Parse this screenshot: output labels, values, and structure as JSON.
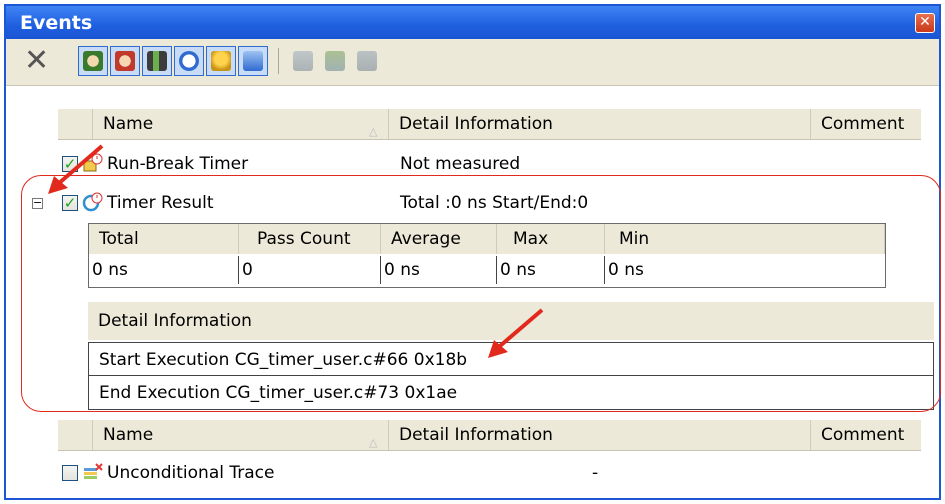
{
  "window": {
    "title": "Events",
    "close_icon": "close-icon"
  },
  "toolbar": {
    "delete_icon": "delete-icon",
    "buttons": [
      "hardware-break-icon",
      "software-break-icon",
      "trace-icon",
      "timer-icon",
      "bell-icon",
      "display-icon"
    ],
    "disabled_buttons": [
      "edit-icon",
      "enable-icon",
      "disable-icon"
    ]
  },
  "columns": {
    "name": "Name",
    "detail": "Detail Information",
    "comment": "Comment"
  },
  "events": [
    {
      "name": "Run-Break Timer",
      "detail": "Not measured",
      "checked": true
    },
    {
      "name": "Timer Result",
      "detail": "Total :0 ns  Start/End:0",
      "checked": true,
      "expanded": true
    },
    {
      "name": "Unconditional Trace",
      "detail": "-",
      "checked": false
    }
  ],
  "timer_table": {
    "headers": [
      "Total",
      "Pass Count",
      "Average",
      "Max",
      "Min"
    ],
    "values": [
      "0 ns",
      "0",
      "0 ns",
      "0 ns",
      "0 ns"
    ]
  },
  "detail_table": {
    "header": "Detail Information",
    "rows": [
      "Start Execution  CG_timer_user.c#66 0x18b",
      "End Execution  CG_timer_user.c#73 0x1ae"
    ]
  },
  "colors": {
    "title_bar": "#1f5fe0",
    "annotation_red": "#e2291d",
    "check_green": "#21a121"
  }
}
